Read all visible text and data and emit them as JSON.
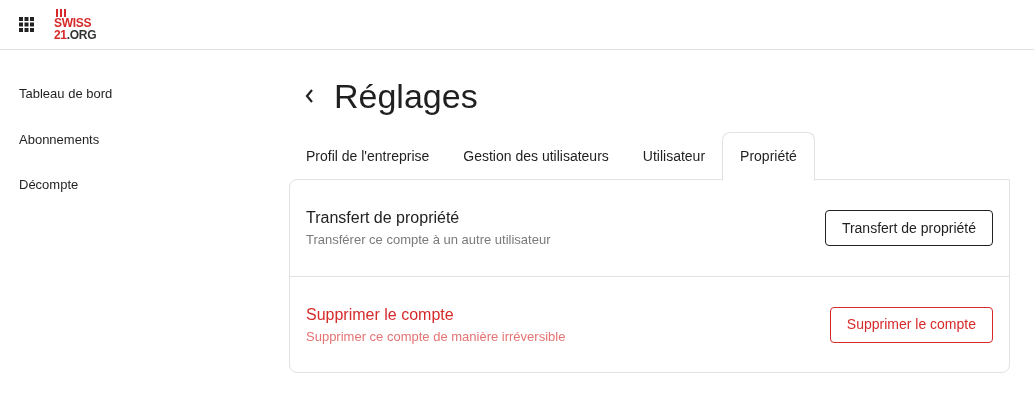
{
  "header": {
    "logo": {
      "top": "SWISS",
      "number": "21",
      "suffix": ".ORG"
    }
  },
  "sidebar": {
    "items": [
      {
        "label": "Tableau de bord"
      },
      {
        "label": "Abonnements"
      },
      {
        "label": "Décompte"
      }
    ]
  },
  "page": {
    "title": "Réglages"
  },
  "tabs": [
    {
      "label": "Profil de l'entreprise",
      "selected": false
    },
    {
      "label": "Gestion des utilisateurs",
      "selected": false
    },
    {
      "label": "Utilisateur",
      "selected": false
    },
    {
      "label": "Propriété",
      "selected": true
    }
  ],
  "sections": [
    {
      "kind": "normal",
      "title": "Transfert de propriété",
      "description": "Transférer ce compte à un autre utilisateur",
      "button": "Transfert de propriété"
    },
    {
      "kind": "danger",
      "title": "Supprimer le compte",
      "description": "Supprimer ce compte de manière irréversible",
      "button": "Supprimer le compte"
    }
  ]
}
